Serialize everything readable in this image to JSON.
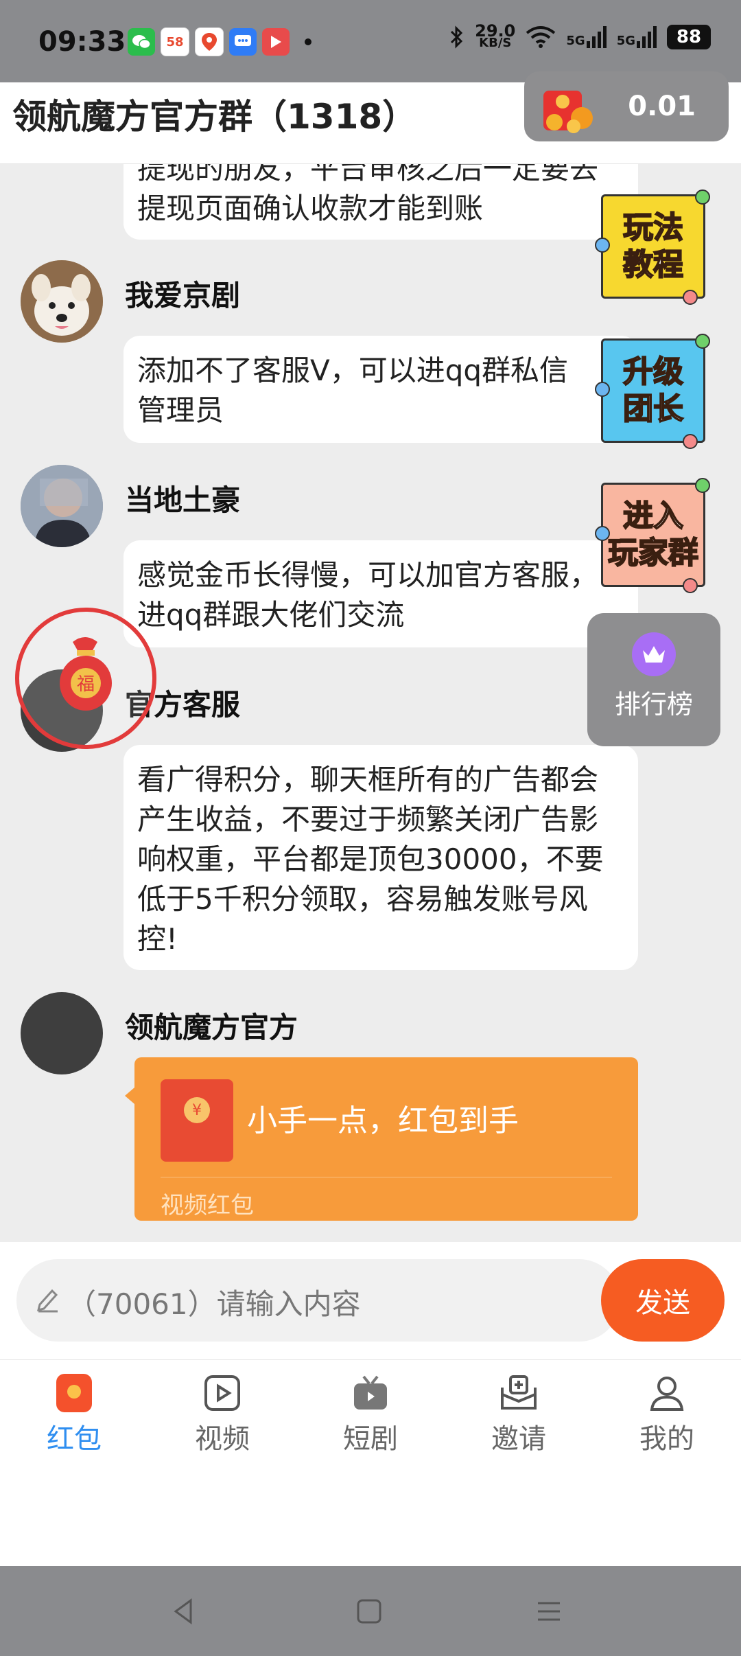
{
  "status_bar": {
    "time": "09:33",
    "apps": [
      "wechat-icon",
      "58-icon",
      "maps-icon",
      "message-icon",
      "video-icon"
    ],
    "net_speed_value": "29.0",
    "net_speed_unit": "KB/S",
    "signal_1": "5G",
    "signal_2": "5G",
    "battery": "88"
  },
  "header": {
    "title": "领航魔方官方群（1318）",
    "reward_amount": "0.01"
  },
  "messages": [
    {
      "sender": "",
      "text": "提现的朋友，平台审核之后一定要去提现页面确认收款才能到账"
    },
    {
      "sender": "我爱京剧",
      "text_line1": "添加不了客服V，可以进qq群私信",
      "text_line2": "管理员"
    },
    {
      "sender": "当地土豪",
      "text": "感觉金币长得慢，可以加官方客服，进qq群跟大佬们交流"
    },
    {
      "sender": "官方客服",
      "text": "看广得积分，聊天框所有的广告都会产生收益，不要过于频繁关闭广告影响权重，平台都是顶包30000，不要低于5千积分领取，容易触发账号风控!"
    },
    {
      "sender": "领航魔方官方",
      "redpacket": {
        "text": "小手一点，红包到手",
        "subtitle": "视频红包",
        "coin_symbol": "¥"
      }
    }
  ],
  "floating_badges": [
    {
      "line1": "玩法",
      "line2": "教程",
      "color": "#f7d82f"
    },
    {
      "line1": "升级",
      "line2": "团长",
      "color": "#58c6ef"
    },
    {
      "line1": "进入",
      "line2": "玩家群",
      "color": "#f9b6a0"
    }
  ],
  "ranking": {
    "label": "排行榜"
  },
  "lucky_bag": {
    "char": "福"
  },
  "input": {
    "placeholder": "（70061）请输入内容",
    "send_label": "发送"
  },
  "nav": {
    "items": [
      {
        "label": "红包",
        "icon": "red-packet-icon",
        "active": true
      },
      {
        "label": "视频",
        "icon": "video-play-icon"
      },
      {
        "label": "短剧",
        "icon": "tv-icon"
      },
      {
        "label": "邀请",
        "icon": "invite-inbox-icon"
      },
      {
        "label": "我的",
        "icon": "profile-icon"
      }
    ]
  },
  "colors": {
    "accent_orange": "#f65c22",
    "nav_active": "#2f8ef0",
    "redpacket_bg": "#f79b3b"
  }
}
